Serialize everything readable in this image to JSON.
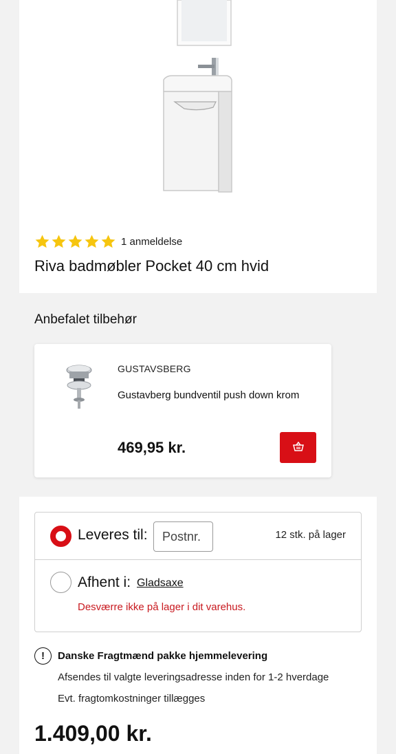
{
  "product": {
    "rating_value": 5,
    "rating_max": 5,
    "review_count": "1 anmeldelse",
    "title": "Riva badmøbler Pocket 40 cm hvid",
    "price": "1.409,00 kr."
  },
  "accessories": {
    "heading": "Anbefalet tilbehør",
    "items": [
      {
        "brand": "GUSTAVSBERG",
        "name": "Gustavberg bundventil push down krom",
        "price": "469,95 kr.",
        "cart_icon": "basket-icon"
      }
    ]
  },
  "delivery": {
    "deliver_label": "Leveres til:",
    "postnr_placeholder": "Postnr.",
    "stock": "12 stk. på lager",
    "pickup_label": "Afhent i:",
    "store": "Gladsaxe",
    "pickup_warning": "Desværre ikke på lager i dit varehus."
  },
  "shipping": {
    "icon": "info-icon",
    "title": "Danske Fragtmænd pakke hjemmelevering",
    "line1": "Afsendes til valgte leveringsadresse inden for 1-2 hverdage",
    "line2": "Evt. fragtomkostninger tillægges"
  },
  "colors": {
    "accent": "#d80f16",
    "star": "#f6c50f",
    "warning": "#c8191f",
    "panel": "#f2f2f2"
  }
}
